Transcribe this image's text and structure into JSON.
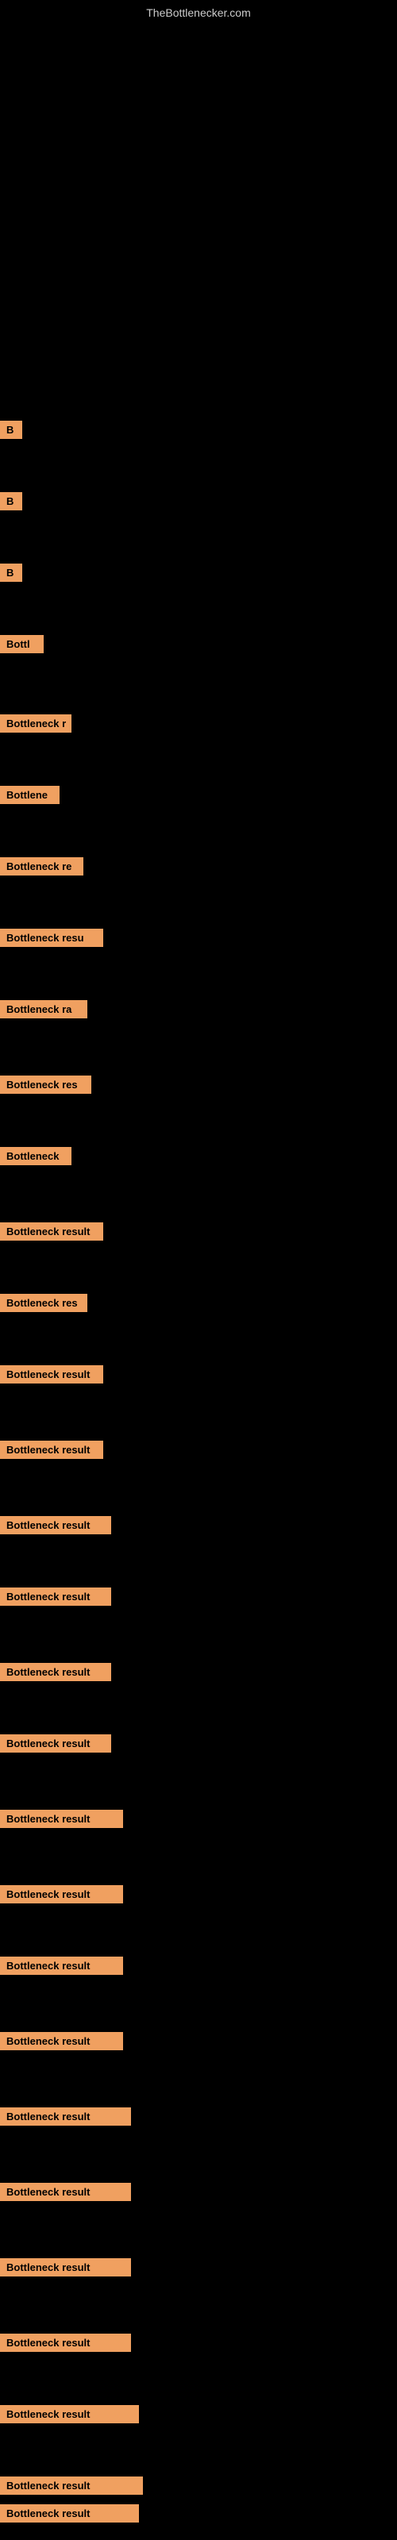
{
  "site": {
    "title": "TheBottlenecker.com"
  },
  "labels": [
    {
      "id": 1,
      "text": "B",
      "class": "label-1"
    },
    {
      "id": 2,
      "text": "B",
      "class": "label-2"
    },
    {
      "id": 3,
      "text": "B",
      "class": "label-3"
    },
    {
      "id": 4,
      "text": "Bottl",
      "class": "label-4"
    },
    {
      "id": 5,
      "text": "Bottleneck r",
      "class": "label-5"
    },
    {
      "id": 6,
      "text": "Bottlene",
      "class": "label-6"
    },
    {
      "id": 7,
      "text": "Bottleneck re",
      "class": "label-7"
    },
    {
      "id": 8,
      "text": "Bottleneck resu",
      "class": "label-8"
    },
    {
      "id": 9,
      "text": "Bottleneck ra",
      "class": "label-9"
    },
    {
      "id": 10,
      "text": "Bottleneck res",
      "class": "label-10"
    },
    {
      "id": 11,
      "text": "Bottleneck",
      "class": "label-11"
    },
    {
      "id": 12,
      "text": "Bottleneck result",
      "class": "label-12"
    },
    {
      "id": 13,
      "text": "Bottleneck res",
      "class": "label-13"
    },
    {
      "id": 14,
      "text": "Bottleneck result",
      "class": "label-14"
    },
    {
      "id": 15,
      "text": "Bottleneck result",
      "class": "label-15"
    },
    {
      "id": 16,
      "text": "Bottleneck result",
      "class": "label-16"
    },
    {
      "id": 17,
      "text": "Bottleneck result",
      "class": "label-17"
    },
    {
      "id": 18,
      "text": "Bottleneck result",
      "class": "label-18"
    },
    {
      "id": 19,
      "text": "Bottleneck result",
      "class": "label-19"
    },
    {
      "id": 20,
      "text": "Bottleneck result",
      "class": "label-20"
    },
    {
      "id": 21,
      "text": "Bottleneck result",
      "class": "label-21"
    },
    {
      "id": 22,
      "text": "Bottleneck result",
      "class": "label-22"
    },
    {
      "id": 23,
      "text": "Bottleneck result",
      "class": "label-23"
    },
    {
      "id": 24,
      "text": "Bottleneck result",
      "class": "label-24"
    },
    {
      "id": 25,
      "text": "Bottleneck result",
      "class": "label-25"
    },
    {
      "id": 26,
      "text": "Bottleneck result",
      "class": "label-26"
    },
    {
      "id": 27,
      "text": "Bottleneck result",
      "class": "label-27"
    },
    {
      "id": 28,
      "text": "Bottleneck result",
      "class": "label-28"
    },
    {
      "id": 29,
      "text": "Bottleneck result",
      "class": "label-29"
    },
    {
      "id": 30,
      "text": "Bottleneck result",
      "class": "label-30"
    }
  ]
}
